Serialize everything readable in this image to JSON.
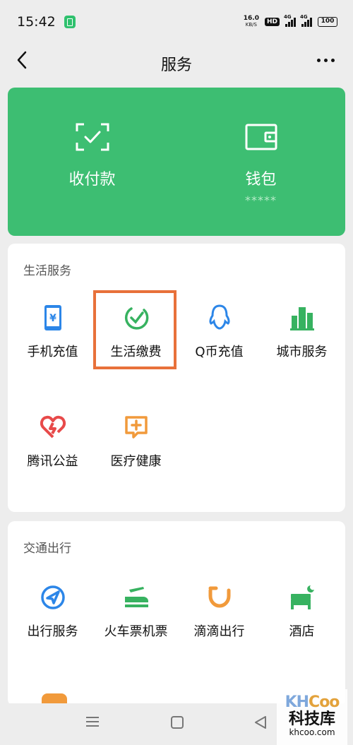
{
  "status_bar": {
    "time": "15:42",
    "net_speed_value": "16.0",
    "net_speed_unit": "KB/S",
    "hd_badge": "HD",
    "signal1_label": "4G",
    "signal2_label": "4G",
    "battery": "100"
  },
  "nav": {
    "title": "服务",
    "back_icon": "chevron-left",
    "more_icon": "ellipsis"
  },
  "pay_card": {
    "color": "#3dbe72",
    "items": [
      {
        "label": "收付款",
        "icon": "scan-check",
        "sub": ""
      },
      {
        "label": "钱包",
        "icon": "wallet",
        "sub": "*****"
      }
    ]
  },
  "life_services": {
    "title": "生活服务",
    "items": [
      {
        "label": "手机充值",
        "icon": "phone-yuan",
        "color": "#2c86e8"
      },
      {
        "label": "生活缴费",
        "icon": "check-circle",
        "color": "#37b260"
      },
      {
        "label": "Q币充值",
        "icon": "qq-penguin",
        "color": "#2c86e8"
      },
      {
        "label": "城市服务",
        "icon": "city-buildings",
        "color": "#37b260"
      },
      {
        "label": "腾讯公益",
        "icon": "charity-heart",
        "color": "#e84a4a"
      },
      {
        "label": "医疗健康",
        "icon": "medical-chat",
        "color": "#f19a3b"
      }
    ],
    "highlight_color": "#e8713a"
  },
  "transport": {
    "title": "交通出行",
    "items": [
      {
        "label": "出行服务",
        "icon": "navigation-arrow",
        "color": "#2c86e8"
      },
      {
        "label": "火车票机票",
        "icon": "train-plane",
        "color": "#37b260"
      },
      {
        "label": "滴滴出行",
        "icon": "didi",
        "color": "#f19a3b"
      },
      {
        "label": "酒店",
        "icon": "hotel-bed",
        "color": "#37b260"
      }
    ]
  },
  "watermark": {
    "logo_a": "KH",
    "logo_b": "Coo",
    "cn": "科技库",
    "url": "khcoo.com"
  }
}
